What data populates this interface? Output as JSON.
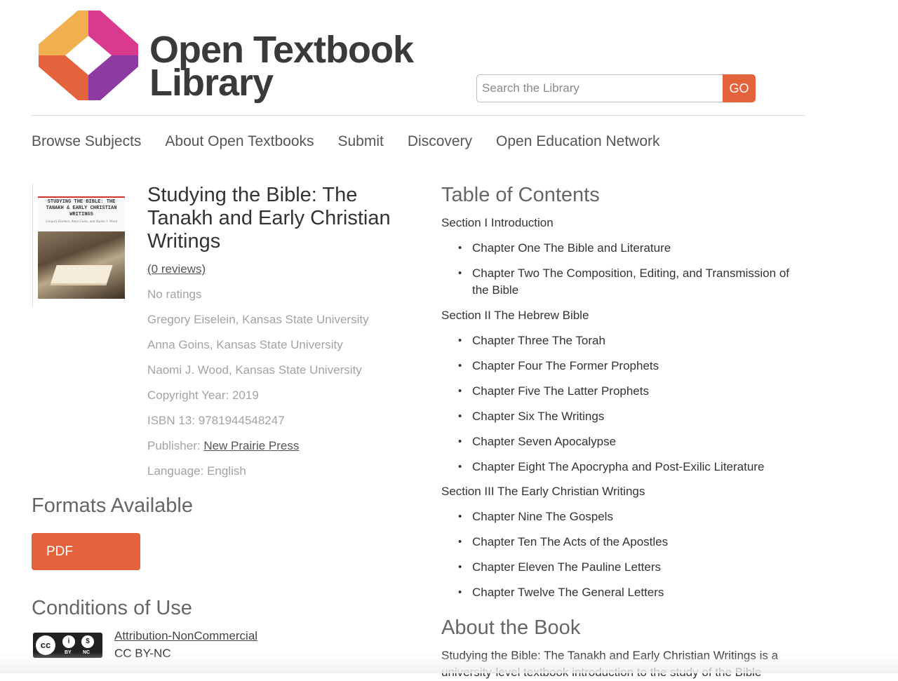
{
  "header": {
    "logo_line1": "Open Textbook",
    "logo_line2": "Library",
    "search_placeholder": "Search the Library",
    "go_label": "GO"
  },
  "nav": {
    "items": [
      {
        "label": "Browse Subjects"
      },
      {
        "label": "About Open Textbooks"
      },
      {
        "label": "Submit"
      },
      {
        "label": "Discovery"
      },
      {
        "label": "Open Education Network"
      }
    ]
  },
  "book": {
    "cover_title": "STUDYING THE BIBLE: THE TANAKH & EARLY CHRISTIAN WRITINGS",
    "cover_authors": "Gregory Eiselein, Anna Goins, and Naomi J. Wood",
    "title": "Studying the Bible: The Tanakh and Early Christian Writings",
    "reviews": "(0 reviews)",
    "ratings": "No ratings",
    "authors": [
      "Gregory Eiselein, Kansas State University",
      "Anna Goins, Kansas State University",
      "Naomi J. Wood, Kansas State University"
    ],
    "copyright": "Copyright Year: 2019",
    "isbn": "ISBN 13: 9781944548247",
    "publisher_label": "Publisher: ",
    "publisher": "New Prairie Press",
    "language": "Language: English"
  },
  "formats": {
    "heading": "Formats Available",
    "pdf_label": "PDF"
  },
  "conditions": {
    "heading": "Conditions of Use",
    "badge_cc": "cc",
    "badge_by": "BY",
    "badge_nc": "NC",
    "license_name": "Attribution-NonCommercial",
    "license_code": "CC BY-NC"
  },
  "toc": {
    "heading": "Table of Contents",
    "s1": "Section I Introduction",
    "c1": "Chapter One The Bible and Literature",
    "c2": "Chapter Two The Composition, Editing, and Transmission of the Bible",
    "s2": "Section II The Hebrew Bible",
    "c3": "Chapter Three The Torah",
    "c4": "Chapter Four The Former Prophets",
    "c5": "Chapter Five The Latter Prophets",
    "c6": "Chapter Six The Writings",
    "c7": "Chapter Seven Apocalypse",
    "c8": "Chapter Eight The Apocrypha and Post-Exilic Literature",
    "s3": "Section III The Early Christian Writings",
    "c9": "Chapter Nine The Gospels",
    "c10": "Chapter Ten The Acts of the Apostles",
    "c11": "Chapter Eleven The Pauline Letters",
    "c12": "Chapter Twelve The General Letters"
  },
  "about": {
    "heading": "About the Book",
    "text": "Studying the Bible: The Tanakh and Early Christian Writings is a university-level textbook introduction to the study of the Bible"
  },
  "colors": {
    "accent": "#e4633d",
    "text_muted": "#a3a3a3",
    "logo_yellow": "#f0b04f",
    "logo_magenta": "#d93a8e",
    "logo_orange": "#e4633d",
    "logo_purple": "#8e3aa3"
  }
}
